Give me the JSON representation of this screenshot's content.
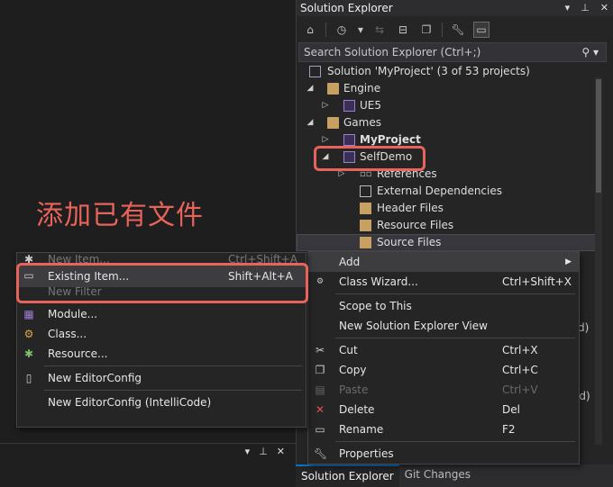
{
  "annotation": "添加已有文件",
  "solution_explorer": {
    "title": "Solution Explorer",
    "search_placeholder": "Search Solution Explorer (Ctrl+;)",
    "tree": [
      {
        "label": "Solution 'MyProject' (3 of 53 projects)"
      },
      {
        "label": "Engine"
      },
      {
        "label": "UE5"
      },
      {
        "label": "Games"
      },
      {
        "label": "MyProject"
      },
      {
        "label": "SelfDemo"
      },
      {
        "label": "References"
      },
      {
        "label": "External Dependencies"
      },
      {
        "label": "Header Files"
      },
      {
        "label": "Resource Files"
      },
      {
        "label": "Source Files"
      }
    ],
    "tabs": [
      "Solution Explorer",
      "Git Changes"
    ]
  },
  "context_menu": {
    "items": [
      {
        "label": "Add",
        "shortcut": ""
      },
      {
        "label": "Class Wizard...",
        "shortcut": "Ctrl+Shift+X"
      },
      {
        "label": "Scope to This",
        "shortcut": ""
      },
      {
        "label": "New Solution Explorer View",
        "shortcut": ""
      },
      {
        "label": "Cut",
        "shortcut": "Ctrl+X"
      },
      {
        "label": "Copy",
        "shortcut": "Ctrl+C"
      },
      {
        "label": "Paste",
        "shortcut": "Ctrl+V"
      },
      {
        "label": "Delete",
        "shortcut": "Del"
      },
      {
        "label": "Rename",
        "shortcut": "F2"
      },
      {
        "label": "Properties",
        "shortcut": ""
      }
    ]
  },
  "add_submenu": {
    "items": [
      {
        "label": "New Item...",
        "shortcut": "Ctrl+Shift+A"
      },
      {
        "label": "Existing Item...",
        "shortcut": "Shift+Alt+A"
      },
      {
        "label": "New Filter",
        "shortcut": ""
      },
      {
        "label": "Module...",
        "shortcut": ""
      },
      {
        "label": "Class...",
        "shortcut": ""
      },
      {
        "label": "Resource...",
        "shortcut": ""
      },
      {
        "label": "New EditorConfig",
        "shortcut": ""
      },
      {
        "label": "New EditorConfig (IntelliCode)",
        "shortcut": ""
      }
    ]
  },
  "side_fragments": [
    "d)",
    "ed)"
  ],
  "colors": {
    "highlight": "#e8635a",
    "background": "#1f1f1f",
    "accent": "#0e70c0"
  }
}
